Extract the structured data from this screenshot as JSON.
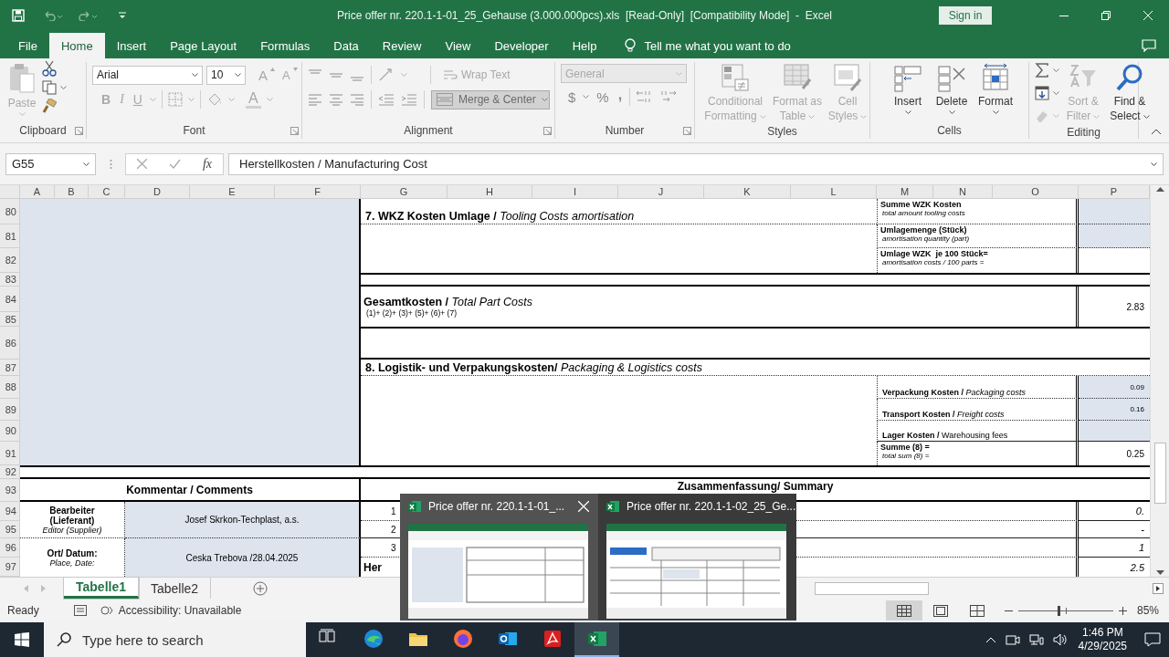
{
  "window": {
    "title": "Price offer nr. 220.1-1-01_25_Gehause (3.000.000pcs).xls  [Read-Only]  [Compatibility Mode]  -  Excel",
    "sign_in": "Sign in"
  },
  "menu": {
    "tabs": [
      {
        "label": "File",
        "selected": false
      },
      {
        "label": "Home",
        "selected": true
      },
      {
        "label": "Insert",
        "selected": false
      },
      {
        "label": "Page Layout",
        "selected": false
      },
      {
        "label": "Formulas",
        "selected": false
      },
      {
        "label": "Data",
        "selected": false
      },
      {
        "label": "Review",
        "selected": false
      },
      {
        "label": "View",
        "selected": false
      },
      {
        "label": "Developer",
        "selected": false
      },
      {
        "label": "Help",
        "selected": false
      }
    ],
    "tell_me": "Tell me what you want to do"
  },
  "ribbon": {
    "clipboard": {
      "label": "Clipboard",
      "paste": {
        "label": "Paste",
        "disabled": true
      }
    },
    "font": {
      "label": "Font",
      "family": "Arial",
      "size": "10",
      "grow": "A",
      "shrink": "A",
      "bold": "B",
      "italic": "I",
      "underline": "U",
      "color_button": "A"
    },
    "alignment": {
      "label": "Alignment",
      "wrap": {
        "label": "Wrap Text",
        "disabled": true
      },
      "merge": {
        "label": "Merge & Center",
        "disabled": true
      }
    },
    "number": {
      "label": "Number",
      "format": {
        "value": "General",
        "disabled": true
      },
      "currency": "$",
      "percent": "%",
      "comma": ","
    },
    "styles": {
      "label": "Styles",
      "buttons": [
        {
          "label": "Conditional Formatting",
          "disabled": true
        },
        {
          "label": "Format as Table",
          "disabled": true
        },
        {
          "label": "Cell Styles",
          "disabled": true
        }
      ]
    },
    "cells": {
      "label": "Cells",
      "buttons": [
        {
          "label": "Insert",
          "disabled": false
        },
        {
          "label": "Delete",
          "disabled": false
        },
        {
          "label": "Format",
          "disabled": false
        }
      ]
    },
    "editing": {
      "label": "Editing",
      "buttons": [
        {
          "label": "Sort & Filter",
          "disabled": true
        },
        {
          "label": "Find & Select",
          "disabled": false
        }
      ]
    }
  },
  "formula_bar": {
    "name_box": "G55",
    "fx": "fx",
    "formula": "Herstellkosten / Manufacturing Cost"
  },
  "sheet": {
    "columns": [
      "A",
      "B",
      "C",
      "D",
      "E",
      "F",
      "G",
      "H",
      "I",
      "J",
      "K",
      "L",
      "M",
      "N",
      "O",
      "P"
    ],
    "rows": [
      "80",
      "81",
      "82",
      "83",
      "84",
      "85",
      "86",
      "87",
      "88",
      "89",
      "90",
      "91",
      "92",
      "93",
      "94",
      "95",
      "96",
      "97"
    ],
    "cells": [
      {
        "lines": [
          "**7. WKZ Kosten Umlage /** *Tooling Costs amortisation*"
        ]
      },
      {
        "lines": [
          "Summe WZK Kosten",
          "total amount tooling costs"
        ]
      },
      {
        "lines": [
          "Umlagemenge (Stück)",
          "amortisation quantity (part)"
        ]
      },
      {
        "lines": [
          "Umlage WZK  je 100 Stück=",
          "amortisation costs / 100 parts ="
        ]
      },
      {
        "lines": [
          "**Gesamtkosten /** *Total Part Costs*",
          "(1)+ (2)+ (3)+ (5)+ (6)+ (7)"
        ]
      },
      {
        "lines": [
          "2.83"
        ]
      },
      {
        "lines": [
          "**8. Logistik- und Verpakungskosten/** *Packaging & Logistics costs*"
        ]
      },
      {
        "lines": [
          "**Verpackung Kosten /** *Packaging costs*"
        ]
      },
      {
        "lines": [
          "0.09"
        ]
      },
      {
        "lines": [
          "**Transport Kosten /** *Freight costs*"
        ]
      },
      {
        "lines": [
          "0.16"
        ]
      },
      {
        "lines": [
          "**Lager Kosten /** Warehousing fees"
        ]
      },
      {
        "lines": [
          "Summe (8) =",
          "total sum (8) ="
        ]
      },
      {
        "lines": [
          "0.25"
        ]
      },
      {
        "lines": [
          "Kommentar / Comments"
        ]
      },
      {
        "lines": [
          "Zusammenfassung/ Summary"
        ]
      },
      {
        "lines": [
          "Bearbeiter (Lieferant)",
          "Editor (Supplier)"
        ]
      },
      {
        "lines": [
          "Josef Skrkon-Techplast, a.s."
        ]
      },
      {
        "lines": [
          "Ort/ Datum:",
          "Place, Date:"
        ]
      },
      {
        "lines": [
          "Ceska Trebova /28.04.2025"
        ]
      },
      {
        "lines": [
          "1"
        ]
      },
      {
        "lines": [
          "0."
        ]
      },
      {
        "lines": [
          "2"
        ]
      },
      {
        "lines": [
          "-"
        ]
      },
      {
        "lines": [
          "3"
        ]
      },
      {
        "lines": [
          "1"
        ]
      },
      {
        "lines": [
          "Her"
        ]
      },
      {
        "lines": [
          "2.5"
        ]
      }
    ]
  },
  "sheet_tabs": [
    {
      "label": "Tabelle1",
      "selected": true
    },
    {
      "label": "Tabelle2",
      "selected": false
    }
  ],
  "status_bar": {
    "mode": "Ready",
    "accessibility": "Accessibility: Unavailable",
    "views": [
      {
        "kind": "normal",
        "selected": true
      },
      {
        "kind": "page_layout",
        "selected": false
      },
      {
        "kind": "page_break",
        "selected": false
      }
    ],
    "zoom_slider": {
      "level": 0.42
    },
    "zoom": "85%"
  },
  "switcher": {
    "windows": [
      {
        "title": "Price offer nr. 220.1-1-01_...",
        "hovered": true
      },
      {
        "title": "Price offer nr. 220.1-1-02_25_Ge...",
        "hovered": false
      }
    ]
  },
  "taskbar": {
    "search_placeholder": "Type here to search",
    "apps": [
      {
        "kind": "task_view",
        "active": false
      },
      {
        "kind": "edge",
        "active": false
      },
      {
        "kind": "explorer",
        "active": false
      },
      {
        "kind": "firefox",
        "active": false
      },
      {
        "kind": "outlook",
        "active": false
      },
      {
        "kind": "acrobat",
        "active": false
      },
      {
        "kind": "excel",
        "active": true
      }
    ],
    "time": "1:46 PM",
    "date": "4/29/2025"
  }
}
